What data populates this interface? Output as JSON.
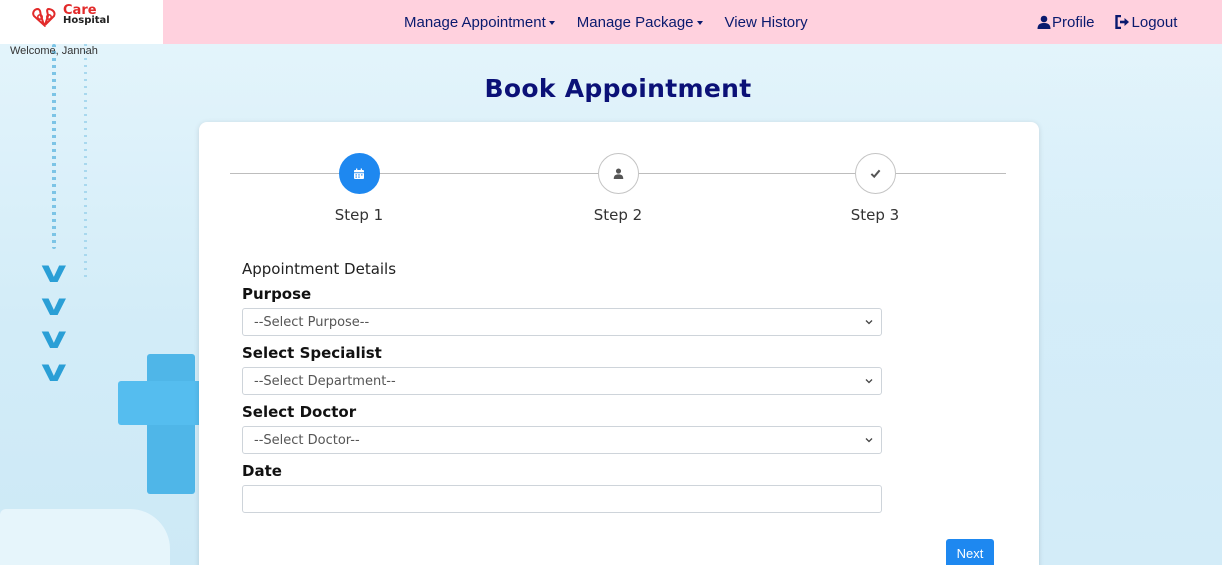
{
  "brand": {
    "name_line1": "Care",
    "name_line2": "Hospital",
    "welcome": "Welcome, Jannah",
    "accent_red": "#e22a2a"
  },
  "nav": {
    "items": [
      {
        "label": "Manage Appointment",
        "has_dropdown": true
      },
      {
        "label": "Manage Package",
        "has_dropdown": true
      },
      {
        "label": "View History",
        "has_dropdown": false
      }
    ],
    "profile_label": "Profile",
    "logout_label": "Logout",
    "bar_color": "#ffd1de",
    "text_color": "#0a1a6e"
  },
  "page": {
    "title": "Book Appointment",
    "title_color": "#0b1177"
  },
  "stepper": {
    "steps": [
      {
        "label": "Step 1",
        "icon": "calendar-icon",
        "active": true
      },
      {
        "label": "Step 2",
        "icon": "user-icon",
        "active": false
      },
      {
        "label": "Step 3",
        "icon": "check-icon",
        "active": false
      }
    ],
    "active_color": "#1e88f0"
  },
  "form": {
    "section_title": "Appointment Details",
    "purpose_label": "Purpose",
    "purpose_value": "--Select Purpose--",
    "specialist_label": "Select Specialist",
    "specialist_value": "--Select Department--",
    "doctor_label": "Select Doctor",
    "doctor_value": "--Select Doctor--",
    "date_label": "Date",
    "date_value": "",
    "next_label": "Next"
  }
}
